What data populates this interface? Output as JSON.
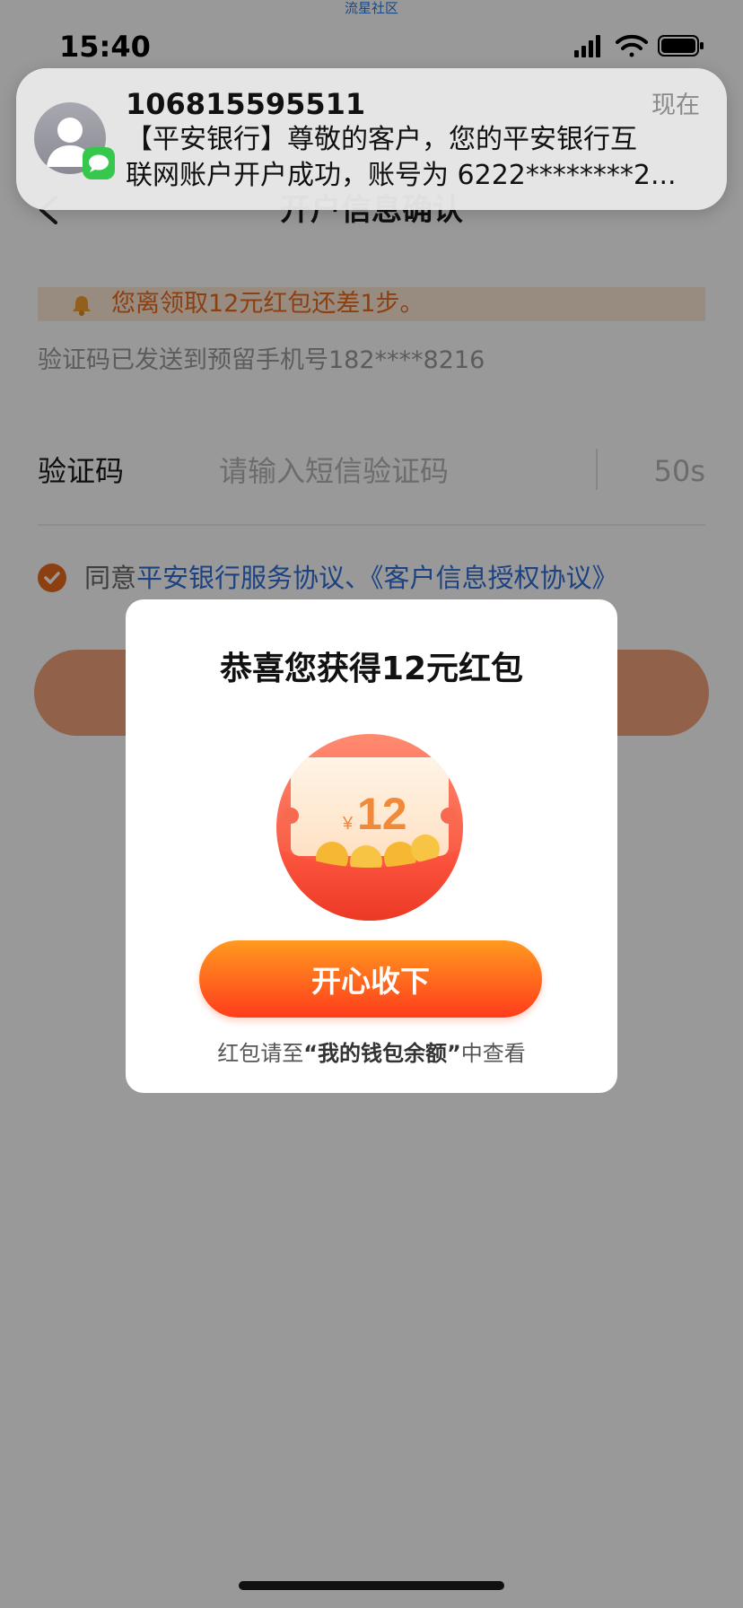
{
  "watermark": "流星社区",
  "status_bar": {
    "time": "15:40"
  },
  "page": {
    "title": "开户信息确认",
    "reward_notice": "您离领取12元红包还差1步。",
    "sms_sent": "验证码已发送到预留手机号182****8216",
    "code_label": "验证码",
    "code_placeholder": "请输入短信验证码",
    "countdown": "50s",
    "agree_prefix": "同意",
    "agree_links": "平安银行服务协议、《客户信息授权协议》"
  },
  "notification": {
    "sender": "106815595511",
    "time": "现在",
    "body_line1": "【平安银行】尊敬的客户，您的平安银行互",
    "body_line2": "联网账户开户成功，账号为 6222********2..."
  },
  "dialog": {
    "title": "恭喜您获得12元红包",
    "packet_amount": "12",
    "packet_currency": "¥",
    "accept_button": "开心收下",
    "hint_prefix": "红包请至",
    "hint_highlight": "“我的钱包余额”",
    "hint_suffix": "中查看"
  },
  "colors": {
    "accent": "#ea6a1d",
    "link": "#2f6ed8",
    "button_top": "#ff9a1f",
    "button_bottom": "#ff3c1c",
    "overlay": "rgba(0,0,0,0.40)"
  },
  "icons": [
    "signal-icon",
    "wifi-icon",
    "battery-icon",
    "back-chevron-icon",
    "bell-icon",
    "checkmark-icon",
    "contact-avatar-icon",
    "messages-app-icon",
    "red-packet-icon"
  ]
}
